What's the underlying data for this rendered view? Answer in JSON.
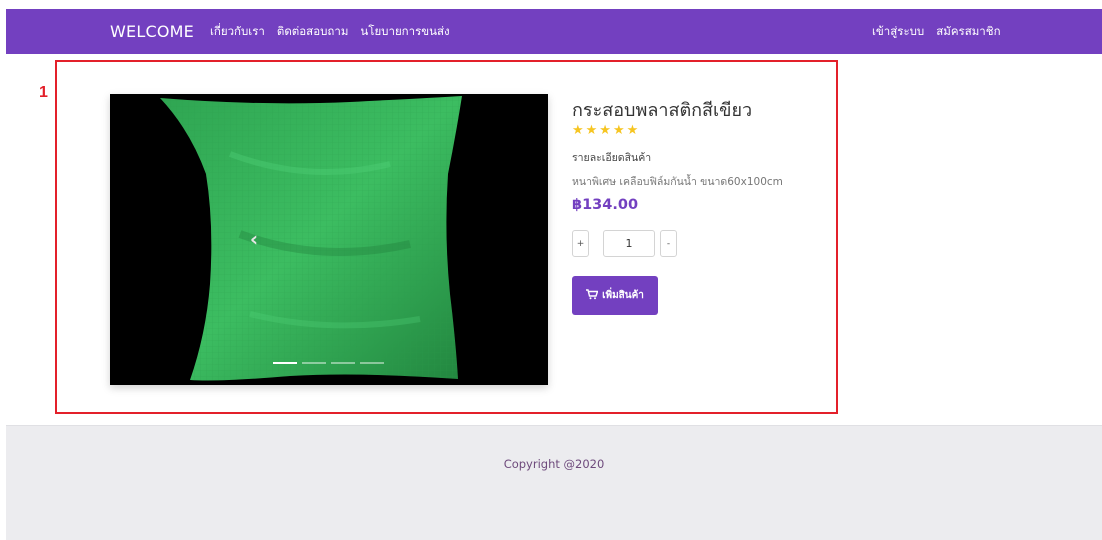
{
  "navbar": {
    "brand": "WELCOME",
    "links": [
      "เกี่ยวกับเรา",
      "ติดต่อสอบถาม",
      "นโยบายการขนส่ง"
    ],
    "right_links": [
      "เข้าสู่ระบบ",
      "สมัครสมาชิก"
    ]
  },
  "annotation": {
    "number": "1"
  },
  "carousel": {
    "prev_icon": "‹",
    "next_icon": "›",
    "slide_count": 4,
    "active_slide": 1
  },
  "product": {
    "title": "กระสอบพลาสติกสีเขียว",
    "rating": 5,
    "rating_display": "★★★★★",
    "details_label": "รายละเอียดสินค้า",
    "description": "หนาพิเศษ เคลือบฟิล์มกันน้ำ ขนาด60x100cm",
    "price": "฿134.00"
  },
  "quantity": {
    "plus_label": "+",
    "minus_label": "-",
    "value": "1"
  },
  "add_to_cart": {
    "label": "เพิ่มสินค้า",
    "icon": "cart-icon"
  },
  "footer": {
    "copyright": "Copyright @2020"
  },
  "colors": {
    "accent": "#7340c0",
    "rating": "#f6c521",
    "annotation": "#e3202a",
    "footer_bg": "#ececef"
  }
}
